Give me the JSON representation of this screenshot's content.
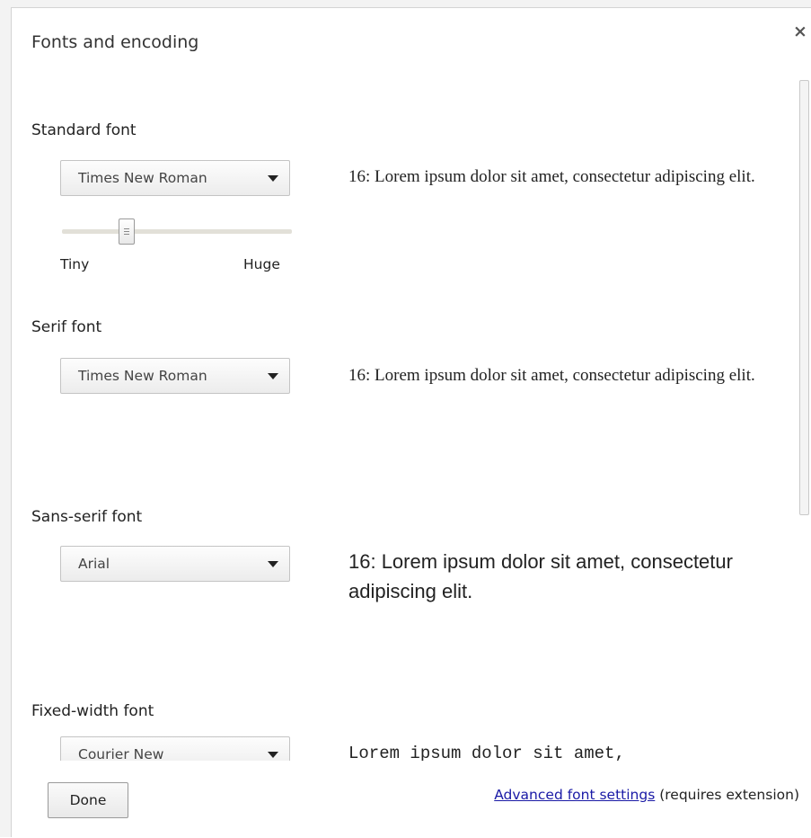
{
  "dialog": {
    "title": "Fonts and encoding",
    "close_label": "×"
  },
  "standard_font": {
    "label": "Standard font",
    "selected": "Times New Roman",
    "sample": "16: Lorem ipsum dolor sit amet, consectetur adipiscing elit.",
    "size_slider": {
      "min_label": "Tiny",
      "max_label": "Huge"
    }
  },
  "serif_font": {
    "label": "Serif font",
    "selected": "Times New Roman",
    "sample": "16: Lorem ipsum dolor sit amet, consectetur adipiscing elit."
  },
  "sans_serif_font": {
    "label": "Sans-serif font",
    "selected": "Arial",
    "sample": "16: Lorem ipsum dolor sit amet, consectetur adipiscing elit."
  },
  "fixed_width_font": {
    "label": "Fixed-width font",
    "selected": "Courier New",
    "sample": "Lorem ipsum dolor sit amet,"
  },
  "footer": {
    "done_label": "Done",
    "advanced_link": "Advanced font settings",
    "advanced_note": " (requires extension)"
  }
}
